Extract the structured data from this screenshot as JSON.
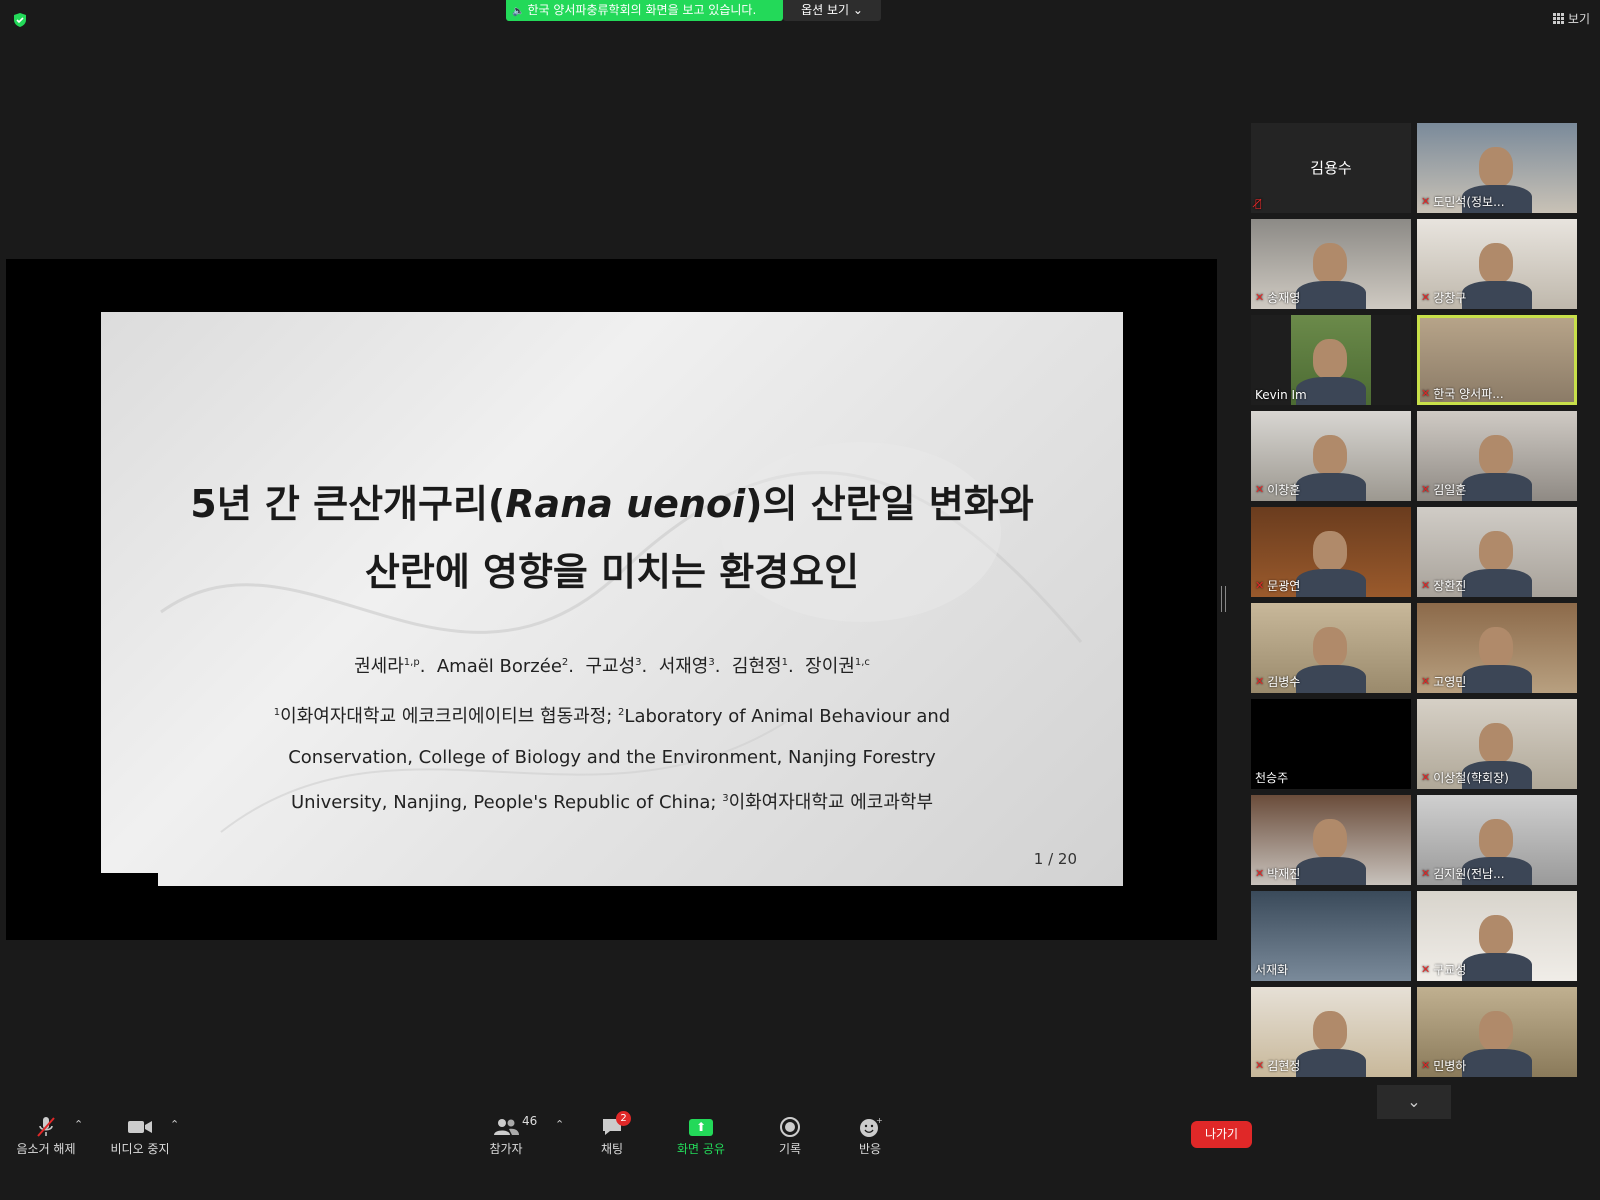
{
  "banner": {
    "text": "한국 양서파충류학회의 화면을 보고 있습니다.",
    "options_label": "옵션 보기",
    "view_label": "보기"
  },
  "slide": {
    "title_line1_pre": "5년 간 큰산개구리(",
    "title_line1_italic": "Rana uenoi",
    "title_line1_post": ")의 산란일 변화와",
    "title_line2": "산란에 영향을 미치는 환경요인",
    "authors": [
      {
        "name": "권세라",
        "sup": "1,p"
      },
      {
        "name": "Amaël Borzée",
        "sup": "2"
      },
      {
        "name": "구교성",
        "sup": "3"
      },
      {
        "name": "서재영",
        "sup": "3"
      },
      {
        "name": "김현정",
        "sup": "1"
      },
      {
        "name": "장이권",
        "sup": "1,c"
      }
    ],
    "affil": [
      {
        "sup": "1",
        "text": "이화여자대학교 에코크리에이티브 협동과정; "
      },
      {
        "sup": "2",
        "text": "Laboratory of Animal Behaviour and Conservation, College of Biology and the Environment, Nanjing Forestry University, Nanjing, People's Republic of China; "
      },
      {
        "sup": "3",
        "text": "이화여자대학교 에코과학부"
      }
    ],
    "page": "1 / 20"
  },
  "participants": [
    {
      "name": "김용수",
      "video": false
    },
    {
      "name": "도민석(정보..."
    },
    {
      "name": "송재영"
    },
    {
      "name": "강창구"
    },
    {
      "name": "Kevin Im"
    },
    {
      "name": "한국 양서파...",
      "active": true
    },
    {
      "name": "이창훈"
    },
    {
      "name": "김일훈"
    },
    {
      "name": "문광연"
    },
    {
      "name": "장환진"
    },
    {
      "name": "김병수"
    },
    {
      "name": "고영민"
    },
    {
      "name": "천승주",
      "video": false
    },
    {
      "name": "이상철(학회장)"
    },
    {
      "name": "박재진"
    },
    {
      "name": "김지원(전남..."
    },
    {
      "name": "서재화"
    },
    {
      "name": "구교성"
    },
    {
      "name": "김현정"
    },
    {
      "name": "민병하"
    }
  ],
  "toolbar": {
    "unmute": "음소거 해제",
    "stop_video": "비디오 중지",
    "participants": "참가자",
    "participants_count": "46",
    "chat": "채팅",
    "chat_badge": "2",
    "share": "화면 공유",
    "record": "기록",
    "reactions": "반응",
    "leave": "나가기"
  },
  "colors": {
    "share_green": "#23d959",
    "leave_red": "#e02828",
    "active_border": "#c8e04a"
  }
}
